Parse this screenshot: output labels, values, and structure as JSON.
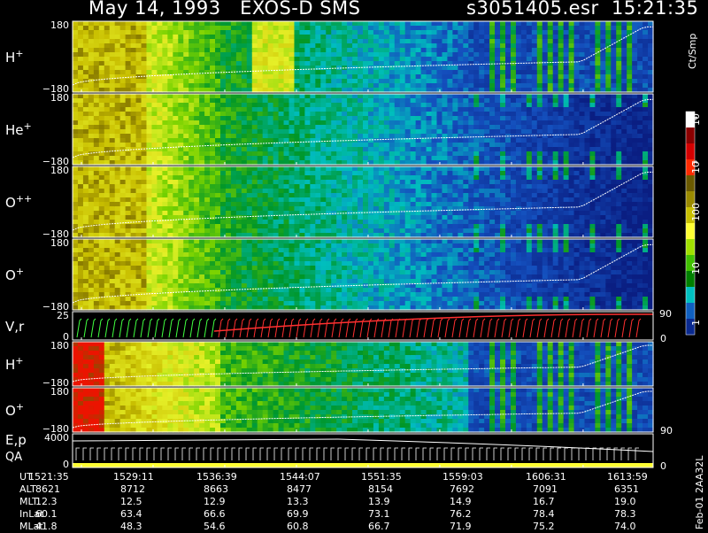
{
  "header": {
    "title_left": "May 14, 1993   EXOS-D SMS",
    "title_right": "s3051405.esr  15:21:35"
  },
  "panels": [
    {
      "label": "H",
      "sup": "+",
      "ytop": "180",
      "ybot": "−180",
      "kind": "spec"
    },
    {
      "label": "He",
      "sup": "+",
      "ytop": "180",
      "ybot": "−180",
      "kind": "spec"
    },
    {
      "label": "O",
      "sup": "++",
      "ytop": "180",
      "ybot": "−180",
      "kind": "spec"
    },
    {
      "label": "O",
      "sup": "+",
      "ytop": "180",
      "ybot": "−180",
      "kind": "spec"
    },
    {
      "label": "V,r",
      "sup": "",
      "ytop": "25",
      "ybot": "0",
      "kind": "vr",
      "right_top": "90",
      "right_bot": "0"
    },
    {
      "label": "H",
      "sup": "+",
      "ytop": "180",
      "ybot": "−180",
      "kind": "spec2"
    },
    {
      "label": "O",
      "sup": "+",
      "ytop": "180",
      "ybot": "−180",
      "kind": "spec2",
      "right_bot": "90"
    },
    {
      "label": "E,p",
      "label2": "QA",
      "sup": "",
      "ytop": "4000",
      "ybot": "0",
      "kind": "ep",
      "right_bot": "0"
    }
  ],
  "colorbar": {
    "unit": "Ct/Smp",
    "ticks": [
      "10",
      "4",
      "10",
      "3",
      "100",
      "10",
      "1"
    ],
    "colors": [
      "#ffffff",
      "#8b0000",
      "#d40000",
      "#ff2a00",
      "#6b5a00",
      "#9a8a00",
      "#c8c000",
      "#ffff33",
      "#a0e000",
      "#40c000",
      "#008000",
      "#00c0c0",
      "#1060c0",
      "#0a2a90"
    ]
  },
  "ephemeris": {
    "rows": [
      {
        "name": "UT",
        "values": [
          "1521:35",
          "1529:11",
          "1536:39",
          "1544:07",
          "1551:35",
          "1559:03",
          "1606:31",
          "1613:59"
        ]
      },
      {
        "name": "ALT",
        "values": [
          "8621",
          "8712",
          "8663",
          "8477",
          "8154",
          "7692",
          "7091",
          "6351"
        ]
      },
      {
        "name": "MLT",
        "values": [
          "12.3",
          "12.5",
          "12.9",
          "13.3",
          "13.9",
          "14.9",
          "16.7",
          "19.0"
        ]
      },
      {
        "name": "InLat",
        "values": [
          "60.1",
          "63.4",
          "66.6",
          "69.9",
          "73.1",
          "76.2",
          "78.4",
          "78.3"
        ]
      },
      {
        "name": "MLat",
        "values": [
          "41.8",
          "48.3",
          "54.6",
          "60.8",
          "66.7",
          "71.9",
          "75.2",
          "74.0"
        ]
      }
    ]
  },
  "footer": {
    "stamp": "Feb-01  2AA32L"
  },
  "chart_data": {
    "type": "heatmap",
    "title": "May 14, 1993   EXOS-D SMS",
    "x_tick_labels": [
      "1521:35",
      "1529:11",
      "1536:39",
      "1544:07",
      "1551:35",
      "1559:03",
      "1606:31",
      "1613:59"
    ],
    "series": [
      {
        "name": "H+",
        "ylim": [
          -180,
          180
        ]
      },
      {
        "name": "He+",
        "ylim": [
          -180,
          180
        ]
      },
      {
        "name": "O++",
        "ylim": [
          -180,
          180
        ]
      },
      {
        "name": "O+",
        "ylim": [
          -180,
          180
        ]
      },
      {
        "name": "V,r",
        "ylim": [
          0,
          25
        ],
        "right_ylim": [
          0,
          90
        ]
      },
      {
        "name": "H+",
        "ylim": [
          -180,
          180
        ]
      },
      {
        "name": "O+",
        "ylim": [
          -180,
          180
        ]
      },
      {
        "name": "E,p",
        "ylim": [
          0,
          4000
        ]
      }
    ],
    "colorbar_range": [
      "1",
      "10",
      "100",
      "10^3",
      "10^4"
    ],
    "z_unit": "Ct/Smp"
  }
}
